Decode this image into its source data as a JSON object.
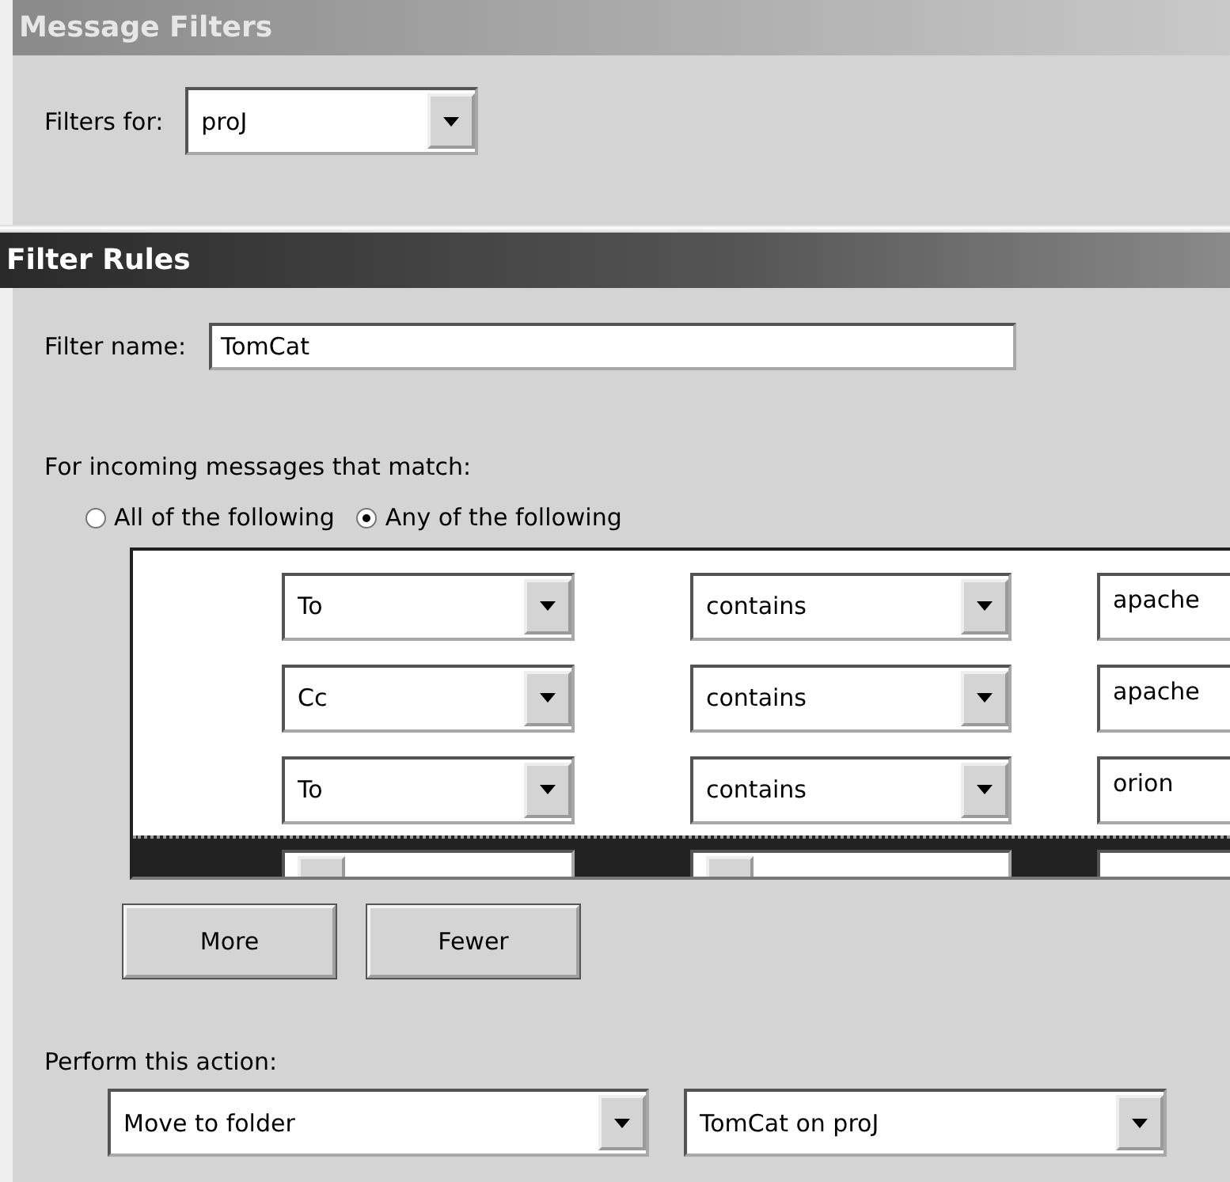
{
  "header": {
    "title": "Message Filters"
  },
  "filters_for": {
    "label": "Filters for:",
    "value": "proJ"
  },
  "section": {
    "title": "Filter Rules"
  },
  "filter_name": {
    "label": "Filter name:",
    "value": "TomCat"
  },
  "match": {
    "label": "For incoming messages that match:",
    "options": [
      {
        "label": "All of the following",
        "selected": false
      },
      {
        "label": "Any of the following",
        "selected": true
      }
    ]
  },
  "rules": [
    {
      "field": "To",
      "operator": "contains",
      "value": "apache",
      "selected": false
    },
    {
      "field": "Cc",
      "operator": "contains",
      "value": "apache",
      "selected": false
    },
    {
      "field": "To",
      "operator": "contains",
      "value": "orion",
      "selected": false
    },
    {
      "selected": true
    }
  ],
  "buttons": [
    "More",
    "Fewer"
  ],
  "action": {
    "label": "Perform this action:",
    "action": "Move to folder",
    "target": "TomCat on proJ"
  }
}
